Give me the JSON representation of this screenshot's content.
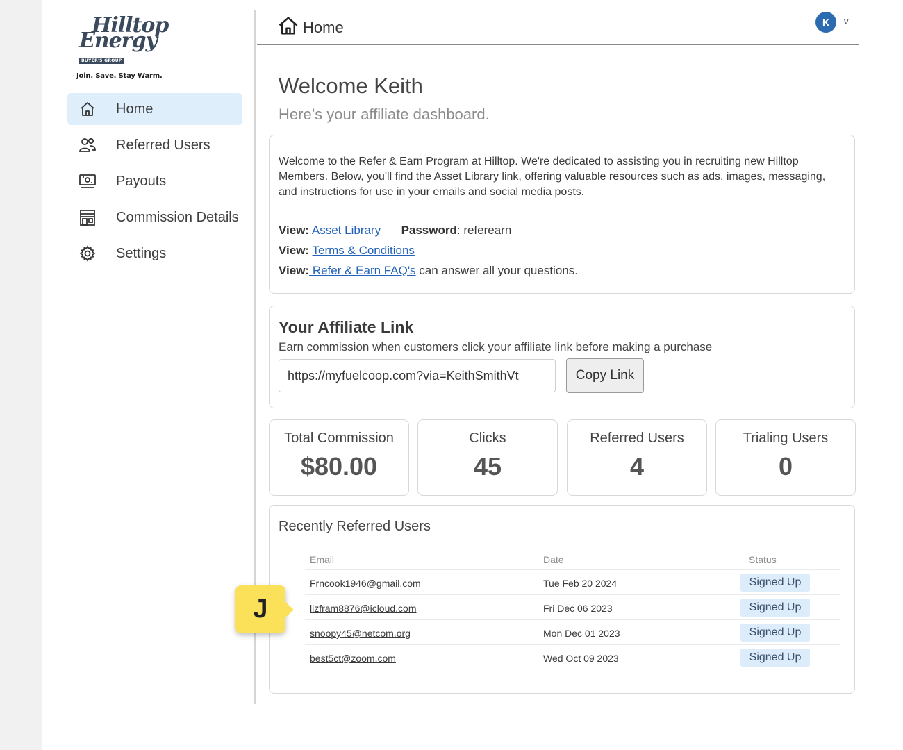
{
  "brand": {
    "logo_line1": "Hilltop",
    "logo_line2": "Energy",
    "logo_badge": "BUYER'S GROUP",
    "tagline": "Join. Save. Stay Warm."
  },
  "sidebar": {
    "items": [
      {
        "label": "Home",
        "icon": "home-icon",
        "active": true
      },
      {
        "label": "Referred Users",
        "icon": "users-icon"
      },
      {
        "label": "Payouts",
        "icon": "money-icon"
      },
      {
        "label": "Commission Details",
        "icon": "store-icon"
      },
      {
        "label": "Settings",
        "icon": "gear-icon"
      }
    ]
  },
  "header": {
    "title": "Home",
    "avatar_initial": "K",
    "caret": "v",
    "accent_color": "#2b6cb0"
  },
  "welcome": {
    "title": "Welcome Keith",
    "subtitle": "Here’s your affiliate dashboard."
  },
  "intro": {
    "text": "Welcome to the Refer & Earn Program at Hilltop. We're dedicated to assisting you in recruiting new Hilltop Members. Below, you'll find the Asset Library link, offering valuable resources such as ads, images, messaging, and instructions for use in your emails and social media posts.",
    "view_label": "View:",
    "asset_library": "Asset Library",
    "password_label": "Password",
    "password_value": ": referearn",
    "terms": "Terms & Conditions",
    "faq": " Refer & Earn FAQ's",
    "faq_suffix": " can answer all your questions."
  },
  "affiliate": {
    "title": "Your Affiliate Link",
    "description": "Earn commission when customers click your affiliate link before making a purchase",
    "link_value": "https://myfuelcoop.com?via=KeithSmithVt",
    "copy_label": "Copy Link"
  },
  "stats": [
    {
      "label": "Total Commission",
      "value": "$80.00"
    },
    {
      "label": "Clicks",
      "value": "45"
    },
    {
      "label": "Referred Users",
      "value": "4"
    },
    {
      "label": "Trialing Users",
      "value": "0"
    }
  ],
  "recent": {
    "title": "Recently Referred Users",
    "columns": {
      "email": "Email",
      "date": "Date",
      "status": "Status"
    },
    "rows": [
      {
        "email": "Frncook1946@gmail.com",
        "date": "Tue Feb 20 2024",
        "status": "Signed Up"
      },
      {
        "email": "lizfram8876@icloud.com",
        "date": "Fri Dec 06 2023",
        "status": "Signed Up"
      },
      {
        "email": "snoopy45@netcom.org",
        "date": "Mon Dec 01 2023",
        "status": "Signed Up"
      },
      {
        "email": "best5ct@zoom.com",
        "date": "Wed Oct 09 2023",
        "status": "Signed Up"
      }
    ]
  },
  "annotation": {
    "letter": "J"
  }
}
